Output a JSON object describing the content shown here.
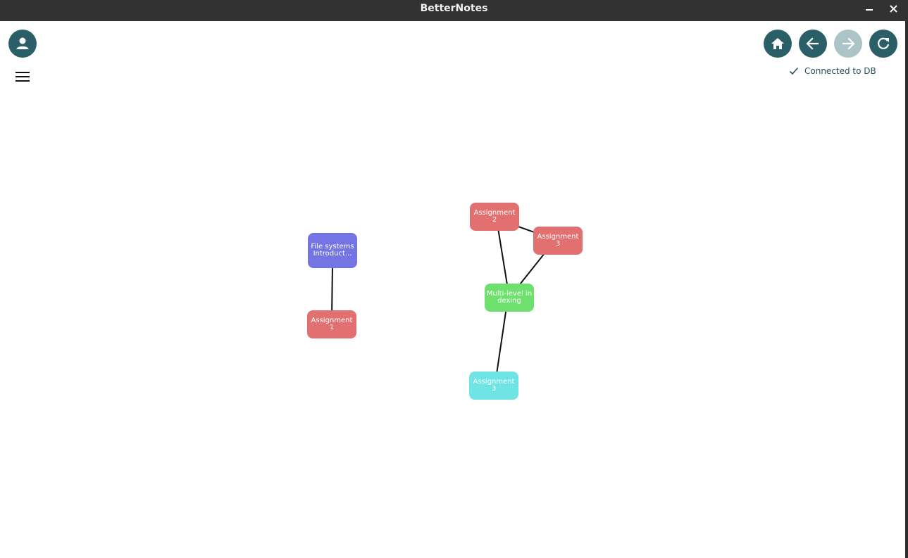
{
  "window": {
    "title": "BetterNotes"
  },
  "toolbar": {
    "avatar_icon": "account-circle-icon",
    "menu_icon": "hamburger-menu-icon",
    "home_icon": "home-icon",
    "back_icon": "arrow-left-icon",
    "forward_icon": "arrow-right-icon",
    "forward_enabled": false,
    "refresh_icon": "refresh-icon"
  },
  "status": {
    "icon": "check-icon",
    "text": "Connected to DB"
  },
  "colors": {
    "titlebar": "#323232",
    "accent": "#2b5f68",
    "accent_disabled": "#aac4c7",
    "node_blue": "#7474e4",
    "node_red": "#e37070",
    "node_green": "#6ee06e",
    "node_cyan": "#6ee4e4"
  },
  "graph": {
    "nodes": [
      {
        "id": "file-systems",
        "label": "File systems Introduct...",
        "color": "#7474e4"
      },
      {
        "id": "assignment-1",
        "label": "Assignment 1",
        "color": "#e37070"
      },
      {
        "id": "assignment-2",
        "label": "Assignment 2",
        "color": "#e37070"
      },
      {
        "id": "assignment-3a",
        "label": "Assignment 3",
        "color": "#e37070"
      },
      {
        "id": "multilevel",
        "label": "Multi-level indexing",
        "color": "#6ee06e"
      },
      {
        "id": "assignment-3b",
        "label": "Assignment 3",
        "color": "#6ee4e4"
      }
    ],
    "edges": [
      {
        "from": "file-systems",
        "to": "assignment-1"
      },
      {
        "from": "assignment-2",
        "to": "assignment-3a"
      },
      {
        "from": "assignment-2",
        "to": "multilevel"
      },
      {
        "from": "assignment-3a",
        "to": "multilevel"
      },
      {
        "from": "multilevel",
        "to": "assignment-3b"
      }
    ]
  }
}
